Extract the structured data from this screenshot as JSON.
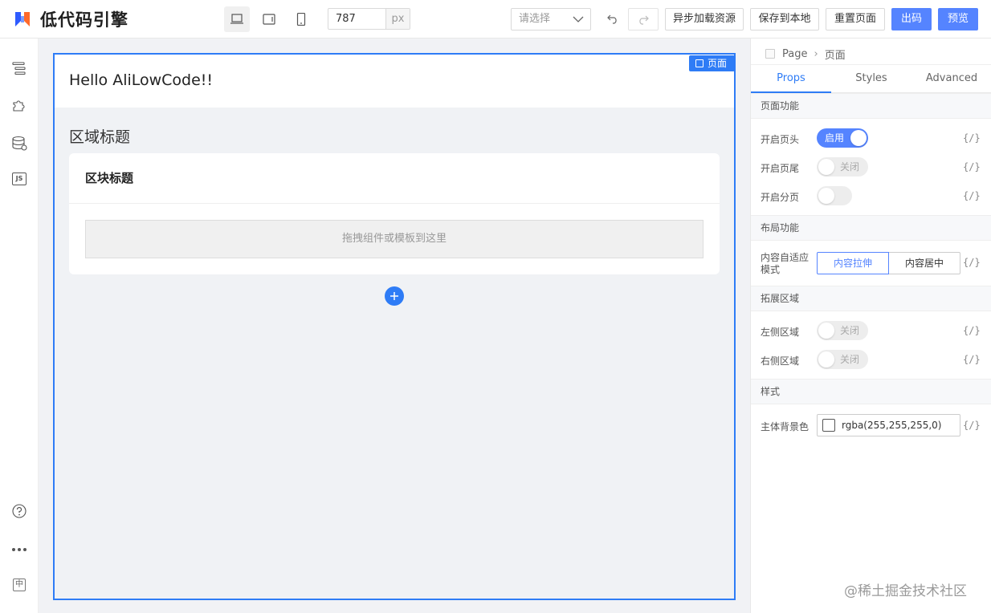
{
  "header": {
    "logo_text": "低代码引擎",
    "width_value": "787",
    "width_unit": "px",
    "select_placeholder": "请选择",
    "buttons": {
      "async_load": "异步加载资源",
      "save_local": "保存到本地",
      "reset_page": "重置页面",
      "export_code": "出码",
      "preview": "预览"
    },
    "device_icons": [
      "desktop-icon",
      "tablet-icon",
      "phone-icon"
    ]
  },
  "leftbar": {
    "icons": [
      "outline-tree-icon",
      "component-puzzle-icon",
      "datasource-icon",
      "js-code-icon",
      "help-icon",
      "more-icon",
      "lang-zh-icon"
    ],
    "js_label": "JS",
    "lang_label": "中"
  },
  "canvas": {
    "page_tag": "页面",
    "header_text": "Hello AliLowCode!!",
    "section_title": "区域标题",
    "card_title": "区块标题",
    "dropzone_text": "拖拽组件或模板到这里"
  },
  "panel": {
    "breadcrumb": [
      "Page",
      "页面"
    ],
    "tabs": [
      "Props",
      "Styles",
      "Advanced"
    ],
    "active_tab": "Props",
    "var_label": "{/}",
    "groups": {
      "page_func": "页面功能",
      "layout_func": "布局功能",
      "extend_area": "拓展区域",
      "style": "样式"
    },
    "props": {
      "header_label": "开启页头",
      "header_toggle": "启用",
      "footer_label": "开启页尾",
      "footer_toggle": "关闭",
      "paging_label": "开启分页",
      "layout_label": "内容自适应模式",
      "layout_opt1": "内容拉伸",
      "layout_opt2": "内容居中",
      "left_area_label": "左侧区域",
      "left_area_toggle": "关闭",
      "right_area_label": "右侧区域",
      "right_area_toggle": "关闭",
      "bg_label": "主体背景色",
      "bg_value": "rgba(255,255,255,0)"
    }
  },
  "watermark": "@稀土掘金技术社区",
  "colors": {
    "primary": "#5584ff",
    "canvas_border": "#2e7cf6",
    "canvas_bg": "#f1f2f5"
  }
}
